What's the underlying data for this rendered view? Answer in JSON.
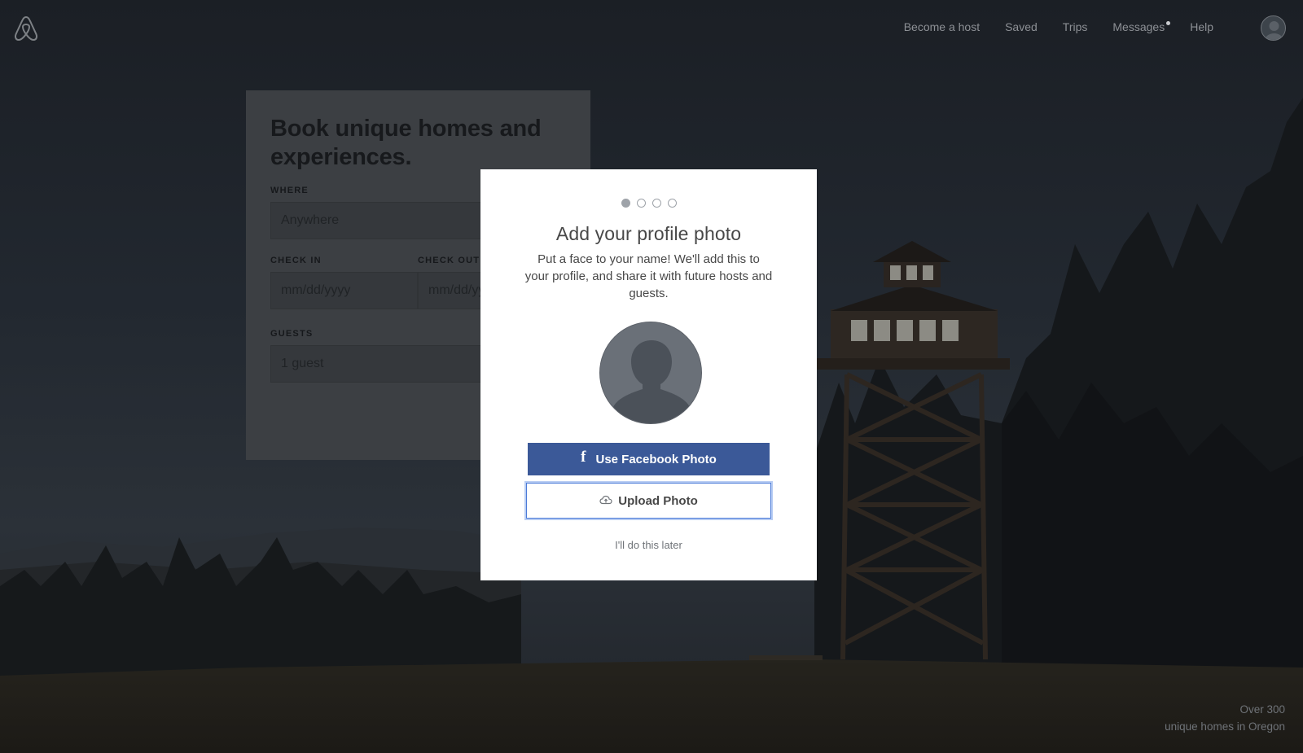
{
  "nav": {
    "links": [
      {
        "label": "Become a host"
      },
      {
        "label": "Saved"
      },
      {
        "label": "Trips"
      },
      {
        "label": "Messages",
        "has_notification": true
      },
      {
        "label": "Help"
      }
    ],
    "logo_icon": "airbnb-logo-icon",
    "avatar_icon": "user-avatar-icon"
  },
  "booking": {
    "title": "Book unique homes and experiences.",
    "where_label": "WHERE",
    "where_placeholder": "Anywhere",
    "checkin_label": "CHECK IN",
    "checkin_placeholder": "mm/dd/yyyy",
    "checkout_label": "CHECK OUT",
    "checkout_placeholder": "mm/dd/yyyy",
    "guests_label": "GUESTS",
    "guests_value": "1 guest"
  },
  "footer": {
    "line1": "Over 300",
    "line2": "unique homes in Oregon"
  },
  "modal": {
    "step_current": 1,
    "step_total": 4,
    "title": "Add your profile photo",
    "description": "Put a face to your name! We'll add this to your profile, and share it with future hosts and guests.",
    "facebook_button": "Use Facebook Photo",
    "facebook_icon": "facebook-icon",
    "upload_button": "Upload Photo",
    "upload_icon": "cloud-upload-icon",
    "later_link": "I'll do this later"
  },
  "colors": {
    "facebook_blue": "#3b5998",
    "upload_focus_border": "#4c7bd8",
    "modal_text": "#484848"
  }
}
